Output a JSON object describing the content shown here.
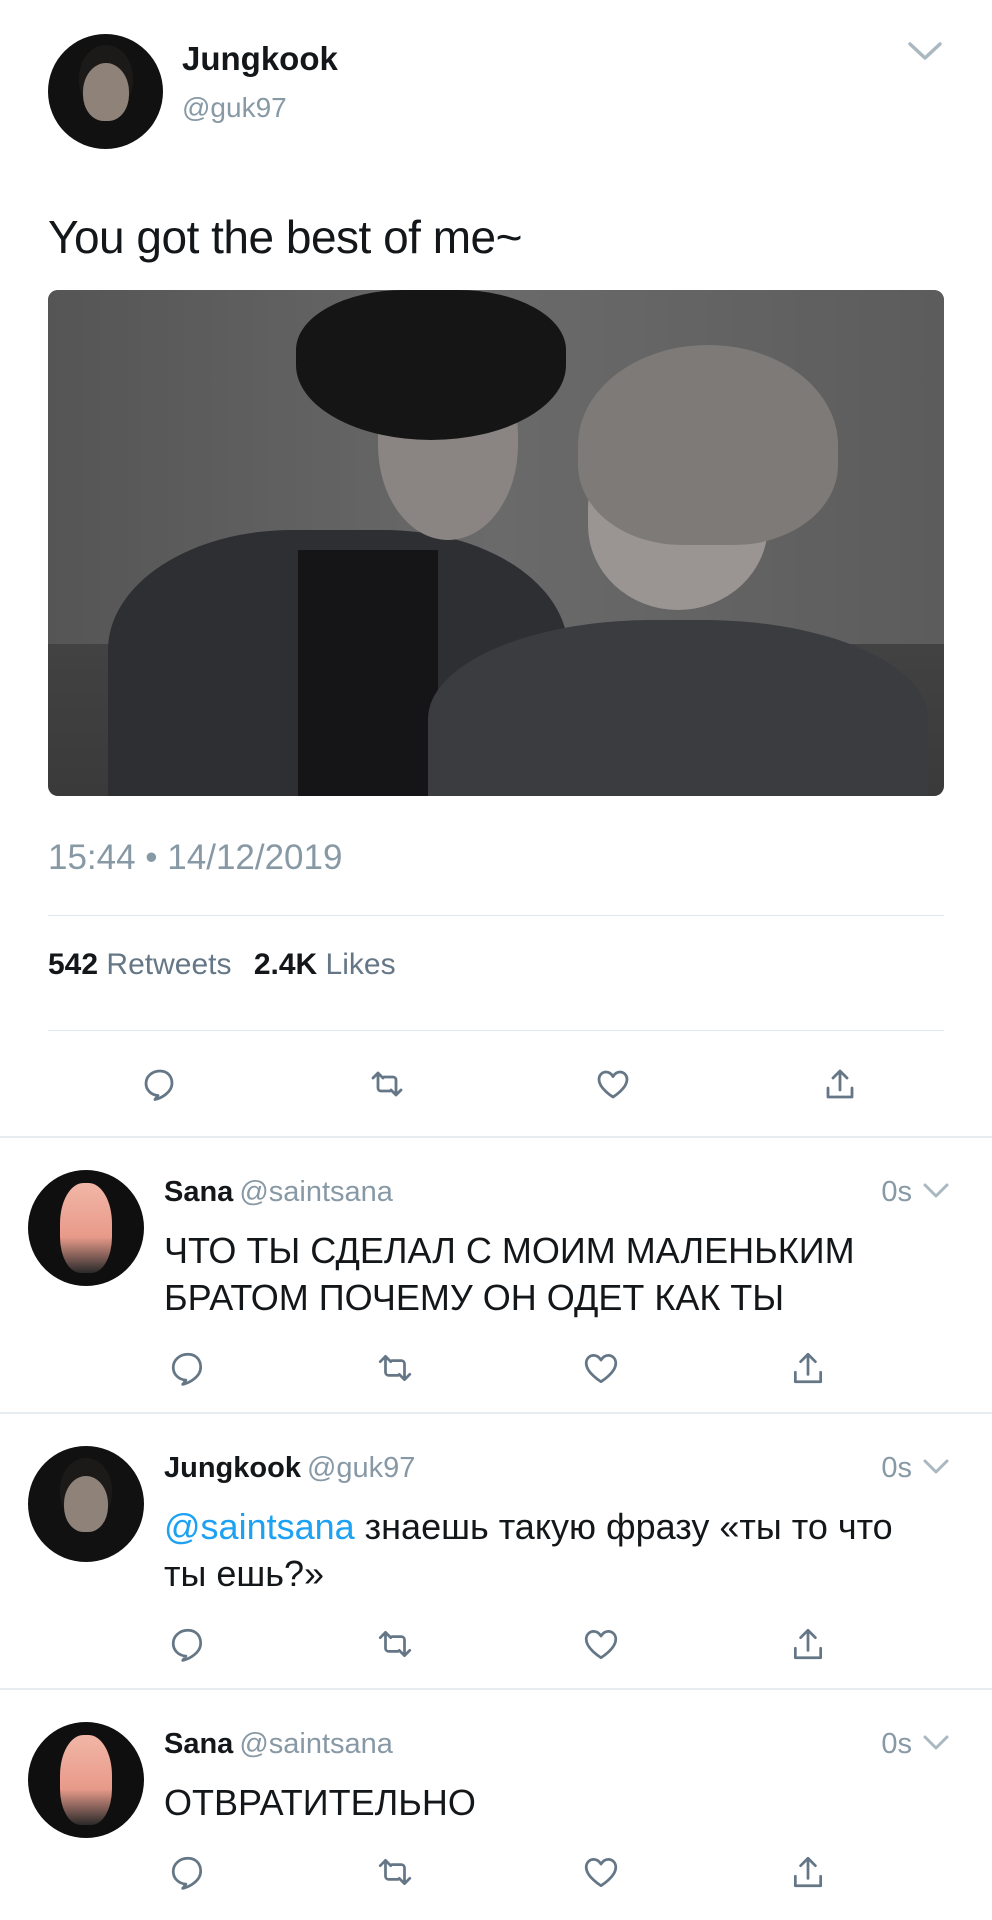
{
  "main_tweet": {
    "author_name": "Jungkook",
    "author_handle": "@guk97",
    "text": "You got the best of me~",
    "timestamp": "15:44 • 14/12/2019",
    "retweets_count": "542",
    "retweets_label": "Retweets",
    "likes_count": "2.4K",
    "likes_label": "Likes"
  },
  "replies": [
    {
      "name": "Sana",
      "handle": "@saintsana",
      "time": "0s",
      "mention": "",
      "text": "ЧТО ТЫ СДЕЛАЛ С МОИМ МАЛЕНЬКИМ БРАТОМ ПОЧЕМУ ОН ОДЕТ КАК ТЫ"
    },
    {
      "name": "Jungkook",
      "handle": "@guk97",
      "time": "0s",
      "mention": "@saintsana",
      "text": " знаешь такую фразу «ты то что ты ешь?»"
    },
    {
      "name": "Sana",
      "handle": "@saintsana",
      "time": "0s",
      "mention": "",
      "text": "ОТВРАТИТЕЛЬНО"
    }
  ],
  "icons": [
    "reply-icon",
    "retweet-icon",
    "like-icon",
    "share-icon",
    "chevron-down-icon"
  ],
  "colors": {
    "link": "#1da1f2",
    "muted": "#8899a6",
    "text": "#14171a",
    "icon": "#657786"
  }
}
